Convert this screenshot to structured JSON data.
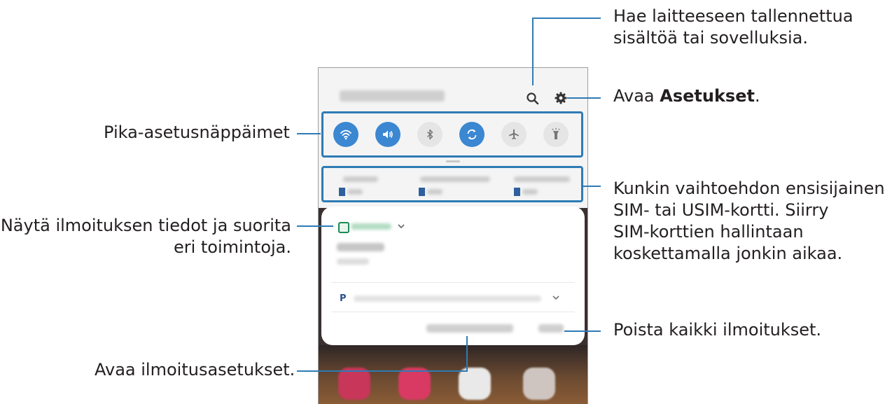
{
  "callouts": {
    "search": [
      "Hae laitteeseen tallennettua",
      "sisältöä tai sovelluksia."
    ],
    "settings_prefix": "Avaa ",
    "settings_bold": "Asetukset",
    "settings_suffix": ".",
    "quick_settings": "Pika-asetusnäppäimet",
    "sim": [
      "Kunkin vaihtoehdon ensisijainen",
      "SIM- tai USIM-kortti. Siirry",
      "SIM-korttien hallintaan",
      "koskettamalla jonkin aikaa."
    ],
    "notification": [
      "Näytä ilmoituksen tiedot ja suorita",
      "eri toimintoja."
    ],
    "clear": "Poista kaikki ilmoitukset.",
    "notif_settings": "Avaa ilmoitusasetukset."
  },
  "quick_settings": [
    {
      "icon": "wifi-icon",
      "state": "on"
    },
    {
      "icon": "sound-icon",
      "state": "on"
    },
    {
      "icon": "bluetooth-icon",
      "state": "off"
    },
    {
      "icon": "auto-rotate-icon",
      "state": "on"
    },
    {
      "icon": "airplane-icon",
      "state": "off"
    },
    {
      "icon": "flashlight-icon",
      "state": "off"
    }
  ],
  "colors": {
    "accent": "#2e7bb5",
    "toggle_on": "#3b87d1",
    "toggle_off": "#e5e5e5"
  }
}
